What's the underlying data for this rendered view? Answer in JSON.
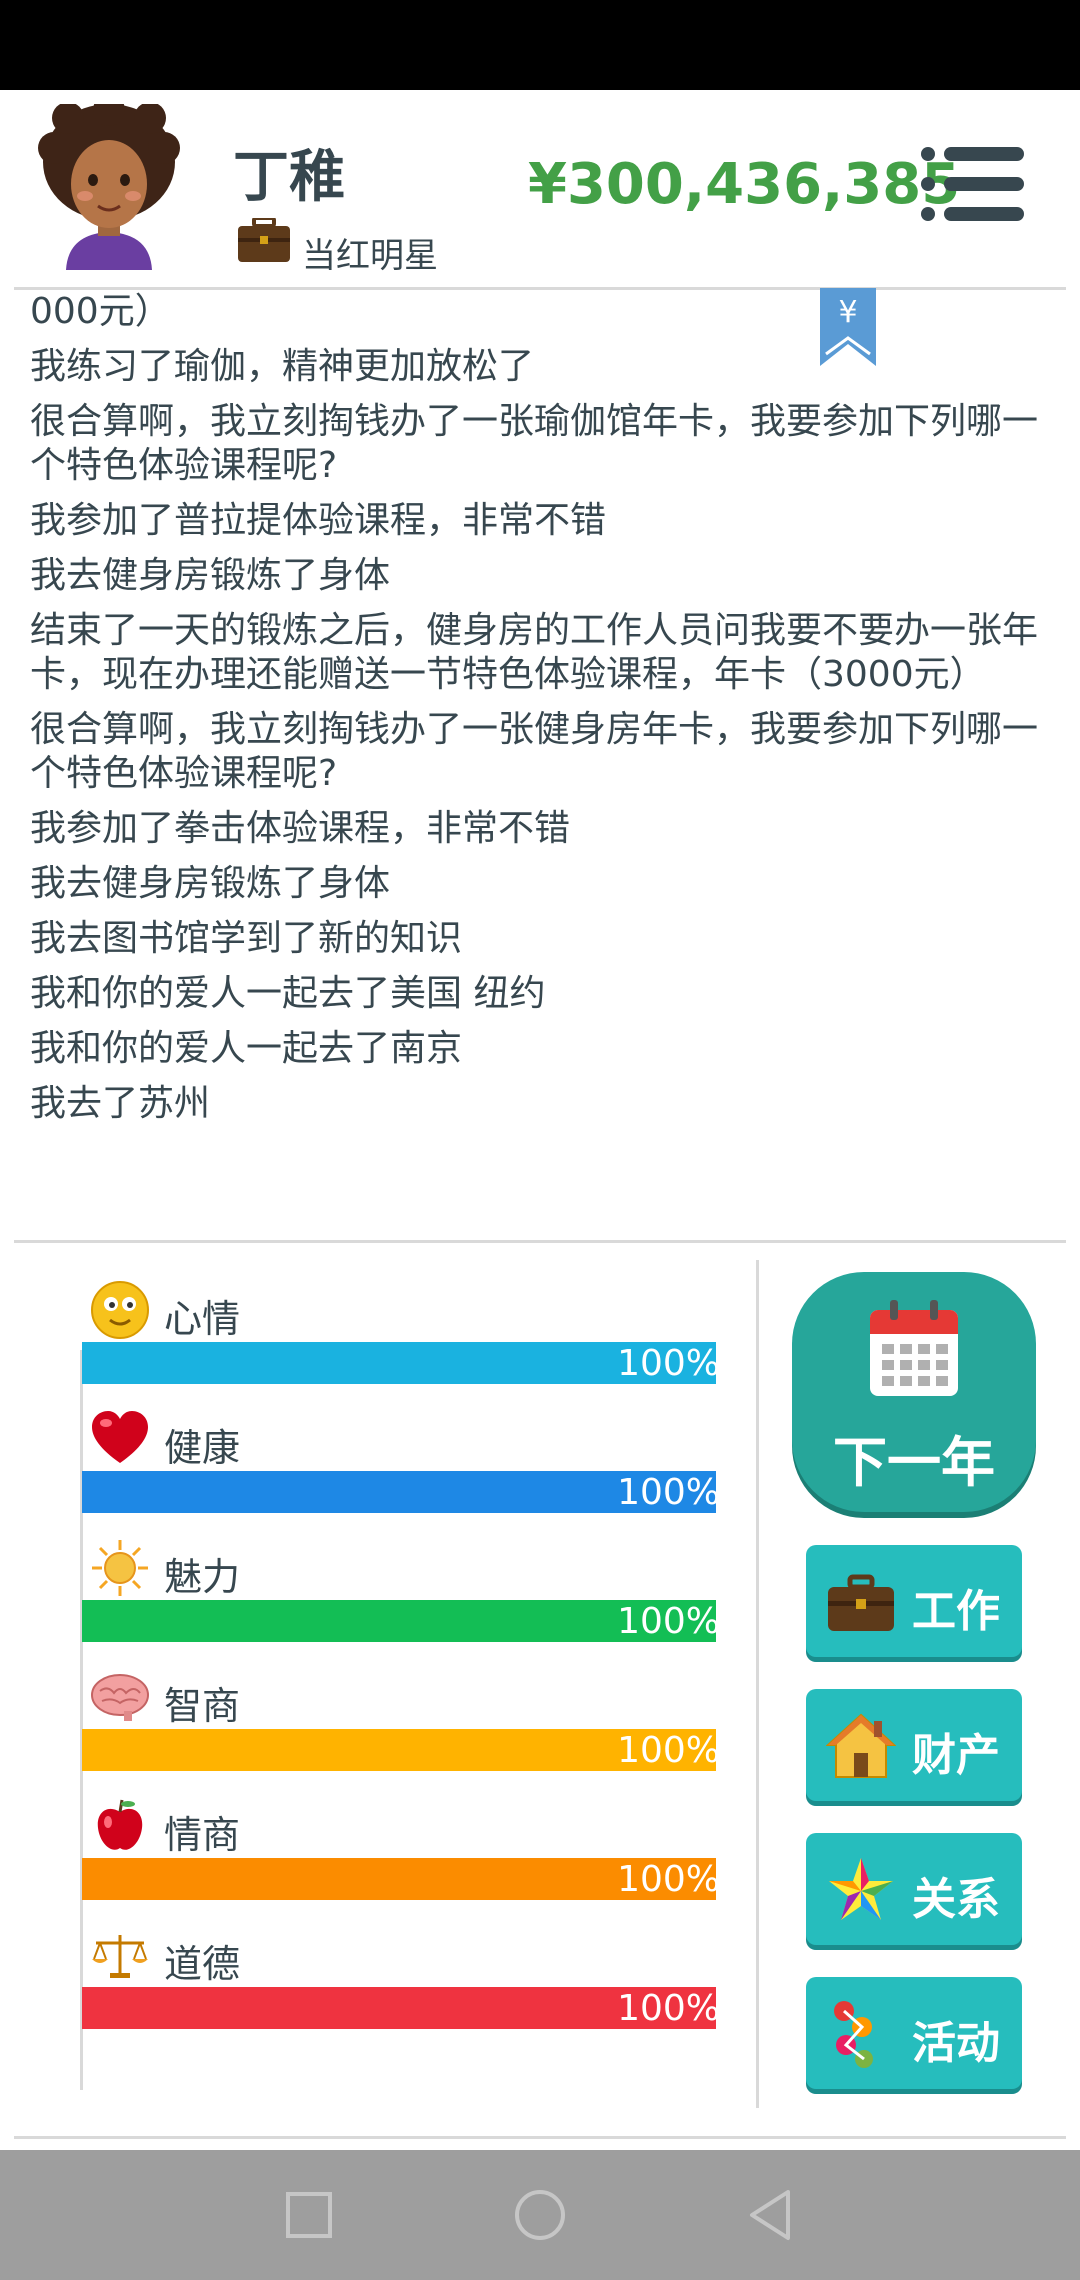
{
  "header": {
    "name": "丁稚",
    "job": "当红明星",
    "money": "¥300,436,385"
  },
  "log": [
    "000元）",
    "我练习了瑜伽，精神更加放松了",
    "很合算啊，我立刻掏钱办了一张瑜伽馆年卡，我要参加下列哪一个特色体验课程呢?",
    "我参加了普拉提体验课程，非常不错",
    "我去健身房锻炼了身体",
    "结束了一天的锻炼之后，健身房的工作人员问我要不要办一张年卡，现在办理还能赠送一节特色体验课程，年卡（3000元）",
    "很合算啊，我立刻掏钱办了一张健身房年卡，我要参加下列哪一个特色体验课程呢?",
    "我参加了拳击体验课程，非常不错",
    "我去健身房锻炼了身体",
    "我去图书馆学到了新的知识",
    "我和你的爱人一起去了美国 纽约",
    "我和你的爱人一起去了南京",
    "我去了苏州"
  ],
  "bookmark_symbol": "¥",
  "stats": [
    {
      "label": "心情",
      "value": "100%",
      "fraction": 1.0,
      "color": "#1ab2e0",
      "icon": "smiley-icon"
    },
    {
      "label": "健康",
      "value": "100%",
      "fraction": 1.0,
      "color": "#1e88e5",
      "icon": "heart-icon"
    },
    {
      "label": "魅力",
      "value": "100%",
      "fraction": 1.0,
      "color": "#13be55",
      "icon": "sun-icon"
    },
    {
      "label": "智商",
      "value": "100%",
      "fraction": 1.0,
      "color": "#ffb300",
      "icon": "brain-icon"
    },
    {
      "label": "情商",
      "value": "100%",
      "fraction": 1.0,
      "color": "#fb8c00",
      "icon": "apple-icon"
    },
    {
      "label": "道德",
      "value": "100%",
      "fraction": 1.0,
      "color": "#ef3340",
      "icon": "scale-icon"
    }
  ],
  "actions": {
    "next_year": "下一年",
    "work": "工作",
    "property": "财产",
    "relations": "关系",
    "activities": "活动"
  },
  "colors": {
    "money": "#43a047",
    "next_button": "#26a69a",
    "side_button": "#26bdbd"
  }
}
